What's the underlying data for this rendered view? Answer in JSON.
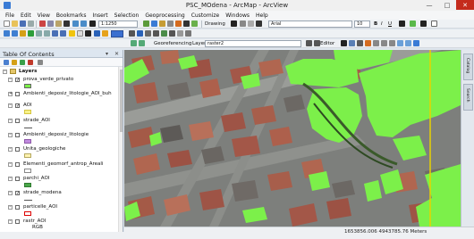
{
  "window": {
    "title": "PSC_MOdena - ArcMap - ArcView"
  },
  "menu": [
    "File",
    "Edit",
    "View",
    "Bookmarks",
    "Insert",
    "Selection",
    "Geoprocessing",
    "Customize",
    "Windows",
    "Help"
  ],
  "toolbar": {
    "scale": "1:1250",
    "drawing_label": "Drawing",
    "georef_label": "Georeferencing",
    "layer_label": "Layer:",
    "layer_value": "raster2",
    "font_value": "Arial",
    "font_size": "10",
    "bold": "B",
    "italic": "I",
    "underline": "U",
    "editor_label": "Editor"
  },
  "toc": {
    "header": "Table Of Contents",
    "layers_root": "Layers",
    "items": [
      {
        "name": "prova_verde_privato",
        "checked": true
      },
      {
        "name": "Ambienti_deposiz_litologie_AOI_buh",
        "checked": false
      },
      {
        "name": "AOI",
        "checked": true
      },
      {
        "name": "strade_AOI",
        "checked": false
      },
      {
        "name": "Ambienti_deposiz_litologie",
        "checked": false
      },
      {
        "name": "Unita_geologiche",
        "checked": false
      },
      {
        "name": "Elementi_geomorf_antrop_Areali",
        "checked": false
      },
      {
        "name": "parchi_AOI",
        "checked": false
      },
      {
        "name": "strade_modena",
        "checked": true
      },
      {
        "name": "particelle_AOI",
        "checked": false
      },
      {
        "name": "rastr_AOI",
        "checked": false
      },
      {
        "name": "RGB",
        "checked": false
      }
    ]
  },
  "dock": {
    "catalog": "Catalog",
    "search": "Search"
  },
  "status": {
    "coords": "1653856.006  4943785.76 Meters"
  },
  "colors": {
    "green_overlay": "#7cf04a",
    "yellow_line": "#e8d200",
    "roads": "#7e807d"
  }
}
